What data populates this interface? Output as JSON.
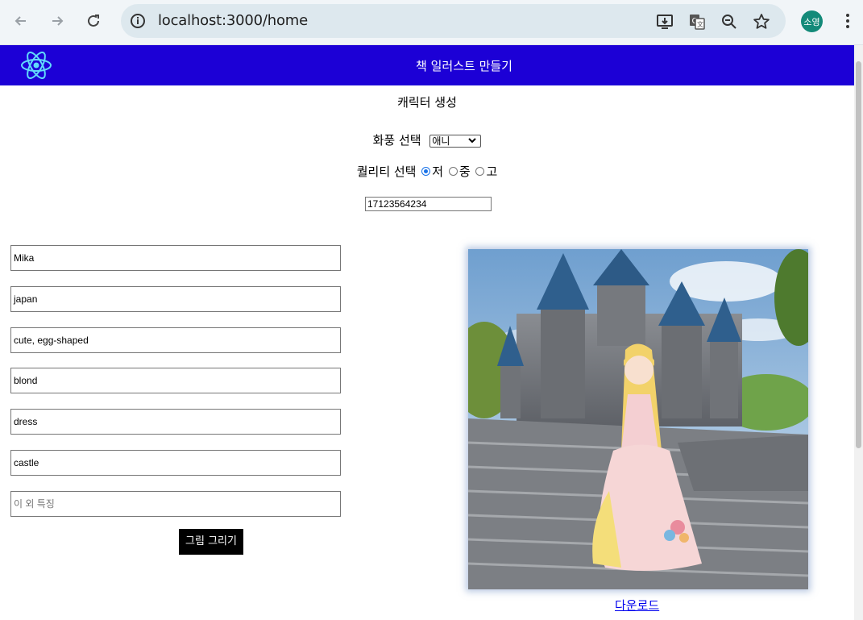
{
  "browser": {
    "url": "localhost:3000/home",
    "profile_initials": "소영"
  },
  "header": {
    "title": "책 일러스트 만들기"
  },
  "form": {
    "section_title": "캐릭터 생성",
    "style_label": "화풍 선택",
    "style_value": "애니",
    "quality_label": "퀄리티 선택",
    "quality_options": [
      "저",
      "중",
      "고"
    ],
    "quality_selected": "저",
    "seed_value": "17123564234",
    "fields": [
      {
        "value": "Mika",
        "placeholder": ""
      },
      {
        "value": "japan",
        "placeholder": ""
      },
      {
        "value": "cute, egg-shaped",
        "placeholder": ""
      },
      {
        "value": "blond",
        "placeholder": ""
      },
      {
        "value": "dress",
        "placeholder": ""
      },
      {
        "value": "castle",
        "placeholder": ""
      },
      {
        "value": "",
        "placeholder": "이 외 특징"
      }
    ],
    "draw_button": "그림 그리기"
  },
  "result": {
    "download_link": "다운로드"
  },
  "colors": {
    "header_bg": "#1c00d6",
    "link": "#0000ee",
    "button_bg": "#000000"
  }
}
